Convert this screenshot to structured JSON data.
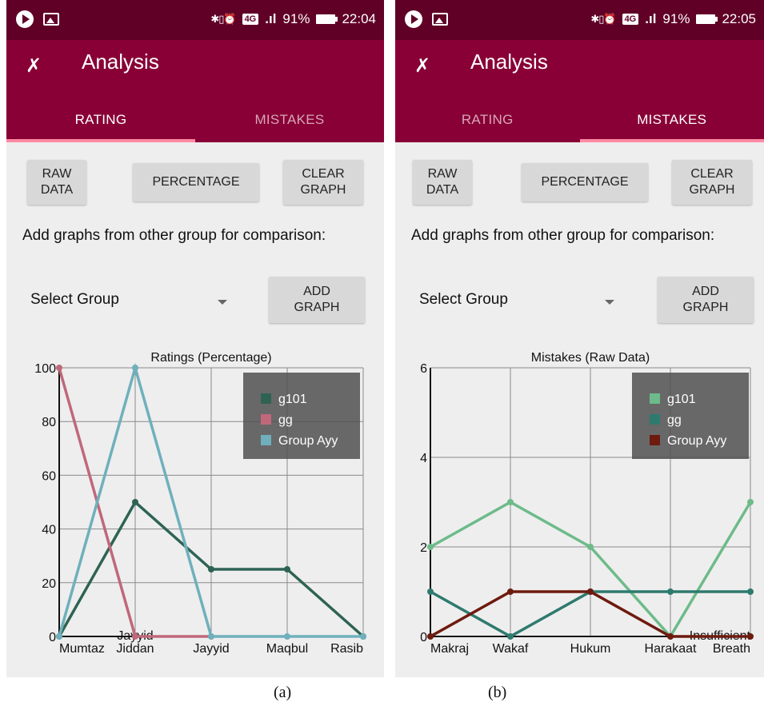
{
  "screens": [
    {
      "id": "a",
      "status": {
        "battery": "91%",
        "time": "22:04",
        "network": "4G"
      },
      "app_title": "Analysis",
      "tabs": [
        {
          "label": "RATING",
          "active": true
        },
        {
          "label": "MISTAKES",
          "active": false
        }
      ],
      "buttons": {
        "raw_line1": "RAW",
        "raw_line2": "DATA",
        "percentage": "PERCENTAGE",
        "clear_line1": "CLEAR",
        "clear_line2": "GRAPH",
        "add_line1": "ADD",
        "add_line2": "GRAPH"
      },
      "prompt": "Add graphs from other group for comparison:",
      "select_group": "Select Group",
      "caption": "(a)"
    },
    {
      "id": "b",
      "status": {
        "battery": "91%",
        "time": "22:05",
        "network": "4G"
      },
      "app_title": "Analysis",
      "tabs": [
        {
          "label": "RATING",
          "active": false
        },
        {
          "label": "MISTAKES",
          "active": true
        }
      ],
      "buttons": {
        "raw_line1": "RAW",
        "raw_line2": "DATA",
        "percentage": "PERCENTAGE",
        "clear_line1": "CLEAR",
        "clear_line2": "GRAPH",
        "add_line1": "ADD",
        "add_line2": "GRAPH"
      },
      "prompt": "Add graphs from other group for comparison:",
      "select_group": "Select Group",
      "caption": "(b)"
    }
  ],
  "chart_data": [
    {
      "type": "line",
      "title": "Ratings (Percentage)",
      "categories": [
        "Mumtaz",
        "Jayyid Jiddan",
        "Jayyid",
        "Maqbul",
        "Rasib"
      ],
      "ylim": [
        0,
        100
      ],
      "yticks": [
        0,
        20,
        40,
        60,
        80,
        100
      ],
      "grid": true,
      "legend_placement": "top-right",
      "series": [
        {
          "name": "g101",
          "color": "#2e6354",
          "values": [
            0,
            50,
            25,
            25,
            0
          ]
        },
        {
          "name": "gg",
          "color": "#c0687a",
          "values": [
            100,
            0,
            0,
            null,
            null
          ]
        },
        {
          "name": "Group Ayy",
          "color": "#6fb0bc",
          "values": [
            0,
            100,
            0,
            0,
            0
          ]
        }
      ]
    },
    {
      "type": "line",
      "title": "Mistakes (Raw Data)",
      "categories": [
        "Makraj",
        "Wakaf",
        "Hukum",
        "Harakaat",
        "Insufficient Breath"
      ],
      "ylim": [
        0,
        6
      ],
      "yticks": [
        0,
        2,
        4,
        6
      ],
      "grid": true,
      "legend_placement": "top-right",
      "series": [
        {
          "name": "g101",
          "color": "#6dbb8a",
          "values": [
            2,
            3,
            2,
            0,
            3
          ]
        },
        {
          "name": "gg",
          "color": "#2e7a6e",
          "values": [
            1,
            0,
            1,
            1,
            1
          ]
        },
        {
          "name": "Group Ayy",
          "color": "#6e1a0e",
          "values": [
            0,
            1,
            1,
            0,
            0
          ]
        }
      ]
    }
  ]
}
